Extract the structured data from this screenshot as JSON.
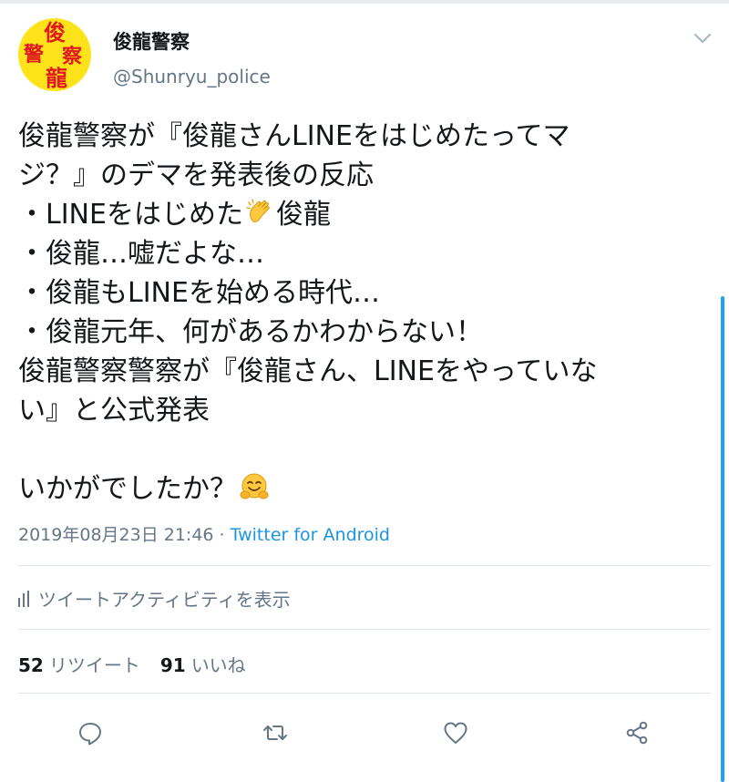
{
  "account": {
    "display_name": "俊龍警察",
    "handle": "@Shunryu_police",
    "avatar_chars": [
      "俊",
      "警",
      "察",
      "龍"
    ]
  },
  "tweet": {
    "lines": [
      "俊龍警察が『俊龍さんLINEをはじめたってマ",
      "ジ？』のデマを発表後の反応",
      "・LINEをはじめた",
      "・俊龍…嘘だよな…",
      "・俊龍もLINEを始める時代…",
      "・俊龍元年、何があるかわからない！",
      "俊龍警察警察が『俊龍さん、LINEをやっていな",
      "い』と公式発表",
      "",
      "いかがでしたか？"
    ],
    "line3_suffix": "俊龍",
    "emojis": [
      "clapping-hands-emoji",
      "hugging-face-emoji"
    ],
    "timestamp": "2019年08月23日 21:46",
    "separator": " · ",
    "source": "Twitter for Android"
  },
  "activity_label": "ツイートアクティビティを表示",
  "stats": {
    "retweets_count": "52",
    "retweets_label": "リツイート",
    "likes_count": "91",
    "likes_label": "いいね"
  },
  "actions": [
    "reply-icon",
    "retweet-icon",
    "like-icon",
    "share-icon"
  ],
  "colors": {
    "accent": "#1da1f2",
    "link": "#1b95e0",
    "secondary_text": "#657786",
    "avatar_bg": "#ffe31a",
    "avatar_text": "#e0191f"
  }
}
